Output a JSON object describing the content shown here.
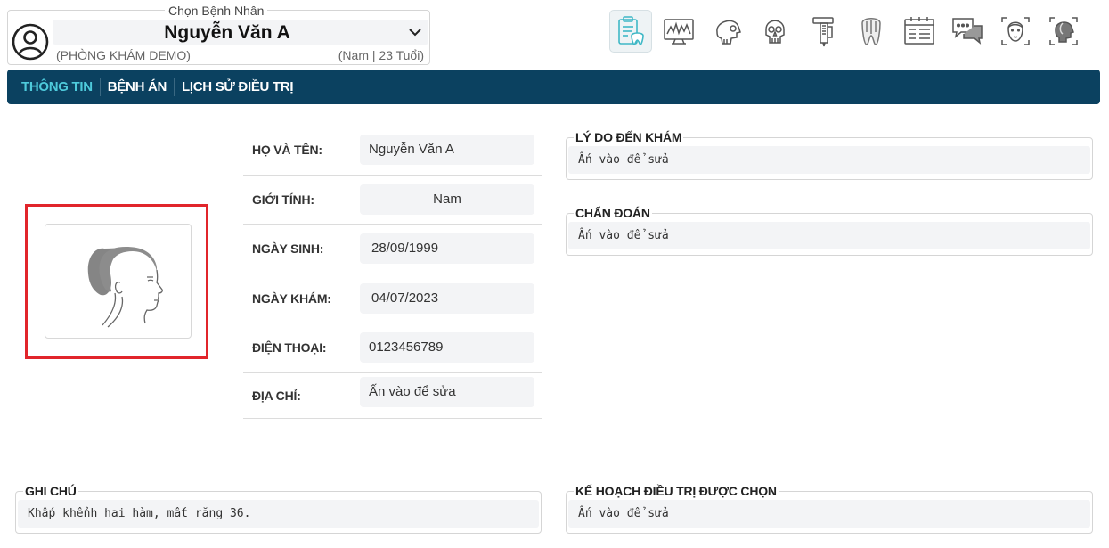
{
  "patient_selector": {
    "legend": "Chọn Bệnh Nhân",
    "name": "Nguyễn Văn A",
    "clinic": "(PHÒNG KHÁM DEMO)",
    "meta": "(Nam | 23 Tuổi)"
  },
  "toolbar": {
    "icons": [
      "clipboard-tooth-icon",
      "xray-monitor-icon",
      "skull-side-icon",
      "skull-front-icon",
      "caliper-icon",
      "tooth-icon",
      "calendar-icon",
      "chat-bubbles-icon",
      "face-front-scan-icon",
      "face-side-scan-icon"
    ],
    "active_index": 0
  },
  "nav": {
    "tabs": [
      {
        "label": "THÔNG TIN",
        "active": true
      },
      {
        "label": "BỆNH ÁN",
        "active": false
      },
      {
        "label": "LỊCH SỬ ĐIỀU TRỊ",
        "active": false
      }
    ]
  },
  "info": {
    "rows": [
      {
        "label": "HỌ VÀ TÊN:",
        "value": "Nguyễn Văn A"
      },
      {
        "label": "GIỚI TÍNH:",
        "value": "Nam"
      },
      {
        "label": "NGÀY SINH:",
        "value": "28/09/1999"
      },
      {
        "label": "NGÀY KHÁM:",
        "value": "04/07/2023"
      },
      {
        "label": "ĐIỆN THOẠI:",
        "value": "0123456789"
      },
      {
        "label": "ĐỊA CHỈ:",
        "value": "Ấn vào để sửa"
      }
    ]
  },
  "fields": {
    "reason": {
      "label": "LÝ DO ĐẾN KHÁM",
      "value": "Ấn vào để sửa"
    },
    "diagnosis": {
      "label": "CHẨN ĐOÁN",
      "value": "Ấn vào để sửa"
    },
    "note": {
      "label": "GHI CHÚ",
      "value": "Khấp khểnh hai hàm, mất răng 36."
    },
    "plan": {
      "label": "KẾ HOẠCH ĐIỀU TRỊ ĐƯỢC CHỌN",
      "value": "Ấn vào để sửa"
    }
  },
  "colors": {
    "nav_bg": "#0b4160",
    "nav_active": "#4ecadb",
    "photo_highlight": "#e1252b",
    "accent_teal": "#3fb8c6"
  }
}
